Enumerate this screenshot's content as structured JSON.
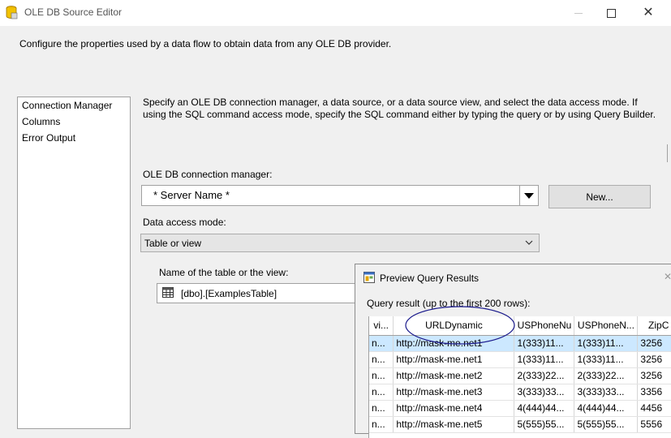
{
  "window": {
    "title": "OLE DB Source Editor",
    "description": "Configure the properties used by a data flow to obtain data from any OLE DB provider."
  },
  "nav": {
    "items": [
      {
        "label": "Connection Manager",
        "selected": true
      },
      {
        "label": "Columns"
      },
      {
        "label": "Error Output"
      }
    ]
  },
  "main": {
    "instructions": "Specify an OLE DB connection manager, a data source, or a data source view, and select the data access mode. If using the SQL command access mode, specify the SQL command either by typing the query or by using Query Builder.",
    "connection_label": "OLE DB connection manager:",
    "connection_value": "* Server Name *",
    "new_button": "New...",
    "access_mode_label": "Data access mode:",
    "access_mode_value": "Table or view",
    "table_label": "Name of the table or the view:",
    "table_value": "[dbo].[ExamplesTable]"
  },
  "preview": {
    "title": "Preview Query Results",
    "query_label": "Query result (up to the first 200 rows):",
    "columns": [
      "vi...",
      "URLDynamic",
      "USPhoneNu",
      "USPhoneN...",
      "ZipC"
    ],
    "rows": [
      [
        "n...",
        "http://mask-me.net1",
        "1(333)11...",
        "1(333)11...",
        "3256"
      ],
      [
        "n...",
        "http://mask-me.net1",
        "1(333)11...",
        "1(333)11...",
        "3256"
      ],
      [
        "n...",
        "http://mask-me.net2",
        "2(333)22...",
        "2(333)22...",
        "3256"
      ],
      [
        "n...",
        "http://mask-me.net3",
        "3(333)33...",
        "3(333)33...",
        "3356"
      ],
      [
        "n...",
        "http://mask-me.net4",
        "4(444)44...",
        "4(444)44...",
        "4456"
      ],
      [
        "n...",
        "http://mask-me.net5",
        "5(555)55...",
        "5(555)55...",
        "5556"
      ]
    ],
    "selected_row": 0
  },
  "icons": {
    "app": "database-icon",
    "preview": "preview-window-icon",
    "table": "table-icon"
  },
  "colors": {
    "selection": "#cce8ff",
    "annotation": "#1a1a8c"
  }
}
